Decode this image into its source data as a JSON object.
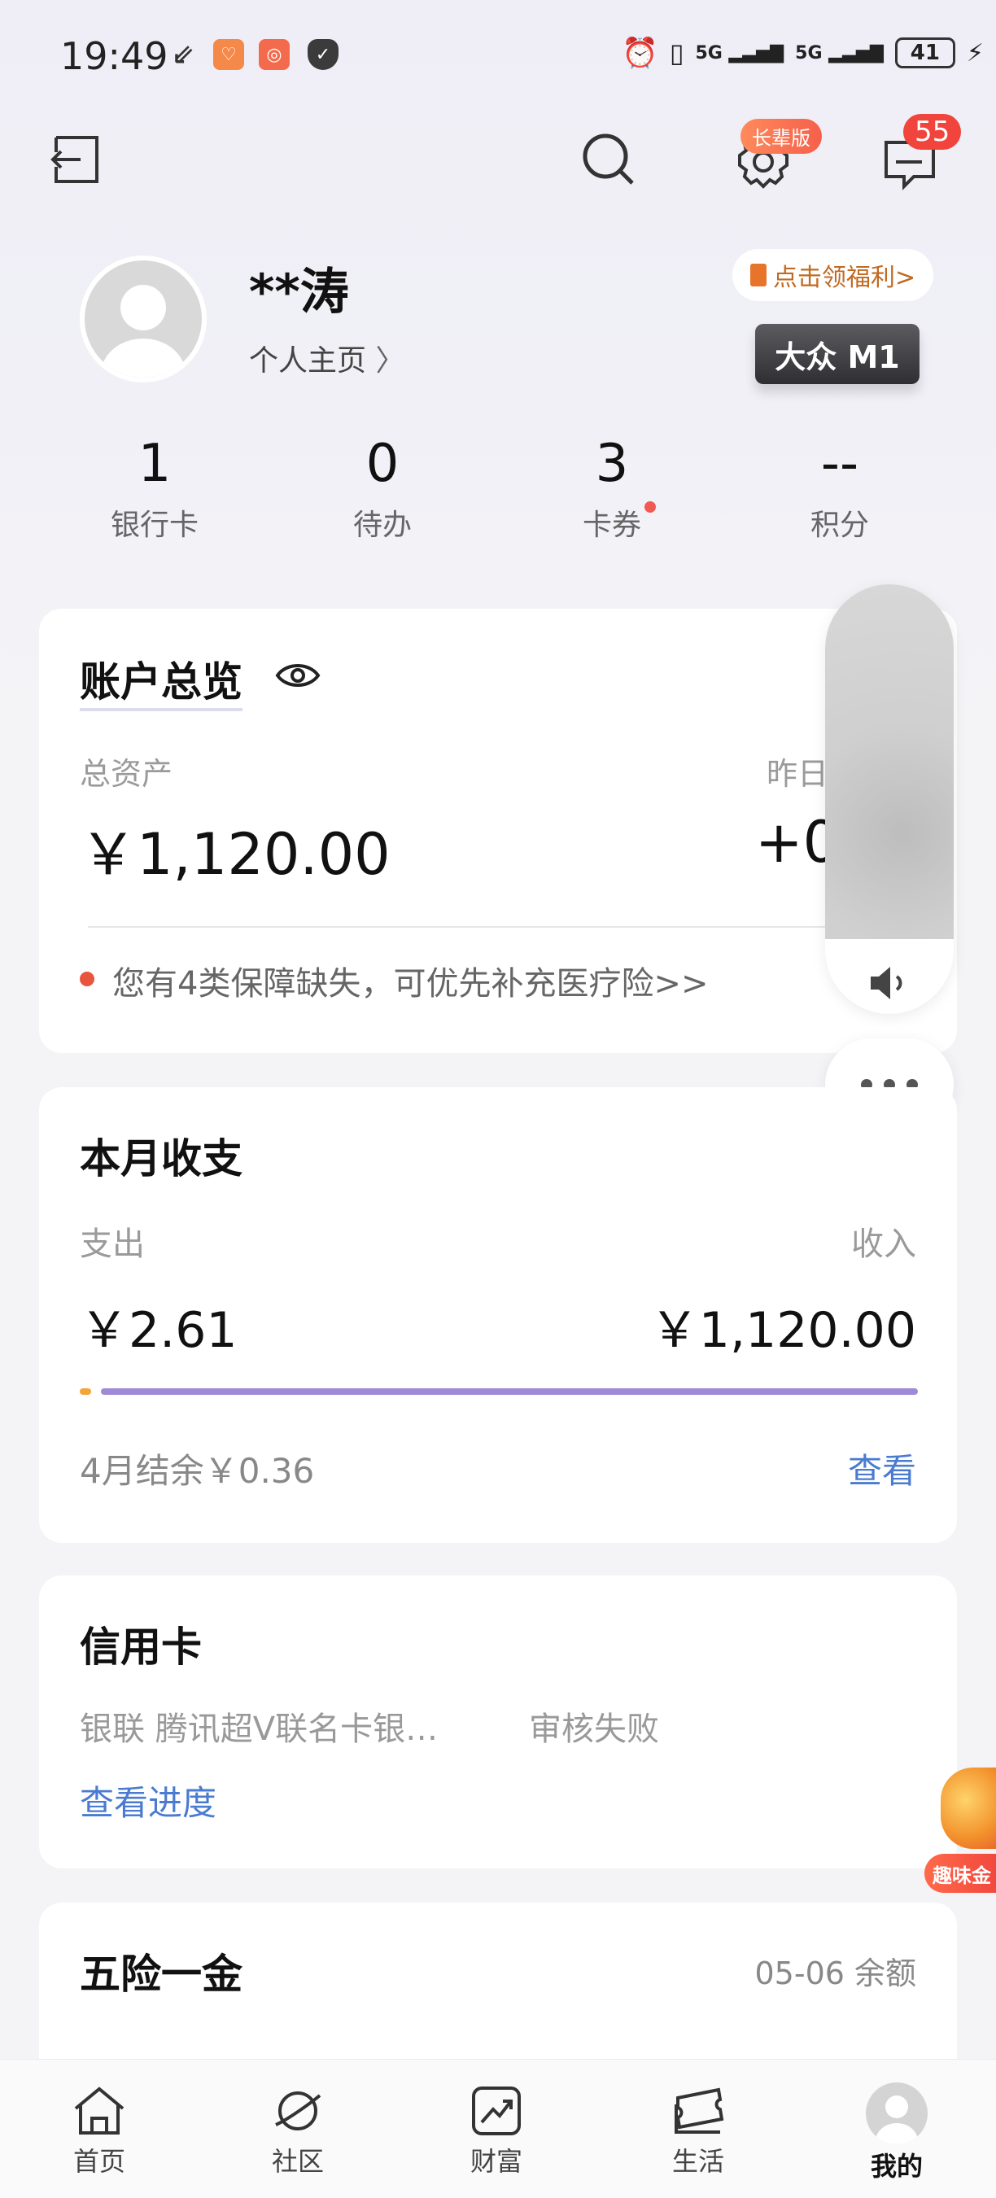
{
  "status_bar": {
    "time": "19:49",
    "signal1": "5G",
    "signal2": "5G",
    "battery": "41"
  },
  "header": {
    "elder_mode_badge": "长辈版",
    "message_count": "55"
  },
  "profile": {
    "name": "**涛",
    "homepage_link": "个人主页",
    "welfare_button": "点击领福利>",
    "level_badge": "大众 M1"
  },
  "stats": [
    {
      "value": "1",
      "label": "银行卡"
    },
    {
      "value": "0",
      "label": "待办"
    },
    {
      "value": "3",
      "label": "卡券"
    },
    {
      "value": "--",
      "label": "积分"
    }
  ],
  "account_overview": {
    "title": "账户总览",
    "total_assets_label": "总资产",
    "total_assets_value": "￥1,120.00",
    "yesterday_label": "昨日",
    "yesterday_value": "+0",
    "notice": "您有4类保障缺失，可优先补充医疗险>>"
  },
  "monthly": {
    "title": "本月收支",
    "expense_label": "支出",
    "income_label": "收入",
    "expense_value": "￥2.61",
    "income_value": "￥1,120.00",
    "expense_share": 0.0023,
    "balance_text": "4月结余￥0.36",
    "view_link": "查看"
  },
  "credit_card": {
    "title": "信用卡",
    "card_name": "银联 腾讯超V联名卡银…",
    "status": "审核失败",
    "progress_link": "查看进度"
  },
  "insurance_fund": {
    "title": "五险一金",
    "meta": "05-06 余额"
  },
  "promo": {
    "text": "趣味金"
  },
  "bottom_nav": [
    {
      "label": "首页",
      "icon": "home-icon"
    },
    {
      "label": "社区",
      "icon": "planet-icon"
    },
    {
      "label": "财富",
      "icon": "chart-up-icon"
    },
    {
      "label": "生活",
      "icon": "ticket-icon"
    },
    {
      "label": "我的",
      "icon": "avatar-icon"
    }
  ],
  "colors": {
    "accent_blue": "#4a7bd0",
    "alert_red": "#f0443d",
    "bar_purple": "#9f8ad6",
    "bar_orange": "#f3a53a"
  }
}
